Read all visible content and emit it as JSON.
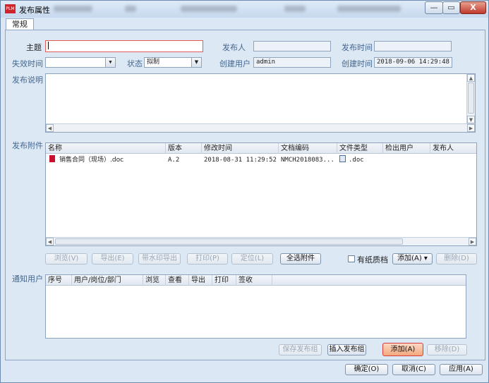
{
  "window": {
    "app_icon": "PLM",
    "title": "发布属性",
    "controls": {
      "minimize": "—",
      "maximize": "▭",
      "close": "X"
    }
  },
  "tabs": [
    {
      "label": "常规"
    }
  ],
  "form": {
    "subject_label": "主题",
    "subject_value": "",
    "publisher_label": "发布人",
    "publisher_value": "",
    "publish_time_label": "发布时间",
    "publish_time_value": "",
    "expire_time_label": "失效时间",
    "expire_time_value": "",
    "status_label": "状态",
    "status_value": "拟制",
    "creator_label": "创建用户",
    "creator_value": "admin",
    "create_time_label": "创建时间",
    "create_time_value": "2018-09-06 14:29:48",
    "description_label": "发布说明",
    "description_value": ""
  },
  "attachments": {
    "section_label": "发布附件",
    "columns": [
      "名称",
      "版本",
      "修改时间",
      "文档编码",
      "文件类型",
      "检出用户",
      "发布人"
    ],
    "rows": [
      {
        "name": "销售合同（现场）.doc",
        "version": "A.2",
        "modified": "2018-08-31 11:29:52",
        "code": "NMCH2018083...",
        "type": ".doc",
        "checkout_user": "",
        "publisher": ""
      }
    ],
    "buttons": {
      "browse": "浏览(V)",
      "export": "导出(E)",
      "export_watermark": "带水印导出",
      "print": "打印(P)",
      "locate": "定位(L)",
      "select_all": "全选附件",
      "paper_copy": "有纸质档",
      "add": "添加(A) ▾",
      "delete": "删除(D)"
    }
  },
  "notify": {
    "section_label": "通知用户",
    "columns": [
      "序号",
      "用户/岗位/部门",
      "浏览",
      "查看",
      "导出",
      "打印",
      "签收"
    ],
    "buttons": {
      "save_group": "保存发布组",
      "insert_group": "插入发布组",
      "add": "添加(A)",
      "remove": "移除(D)"
    }
  },
  "footer": {
    "ok": "确定(O)",
    "cancel": "取消(C)",
    "apply": "应用(A)"
  },
  "colors": {
    "accent": "#44668f",
    "focus_border": "#e15a5a",
    "active_button": "#f3a87c",
    "doc_icon": "#c8102e"
  }
}
